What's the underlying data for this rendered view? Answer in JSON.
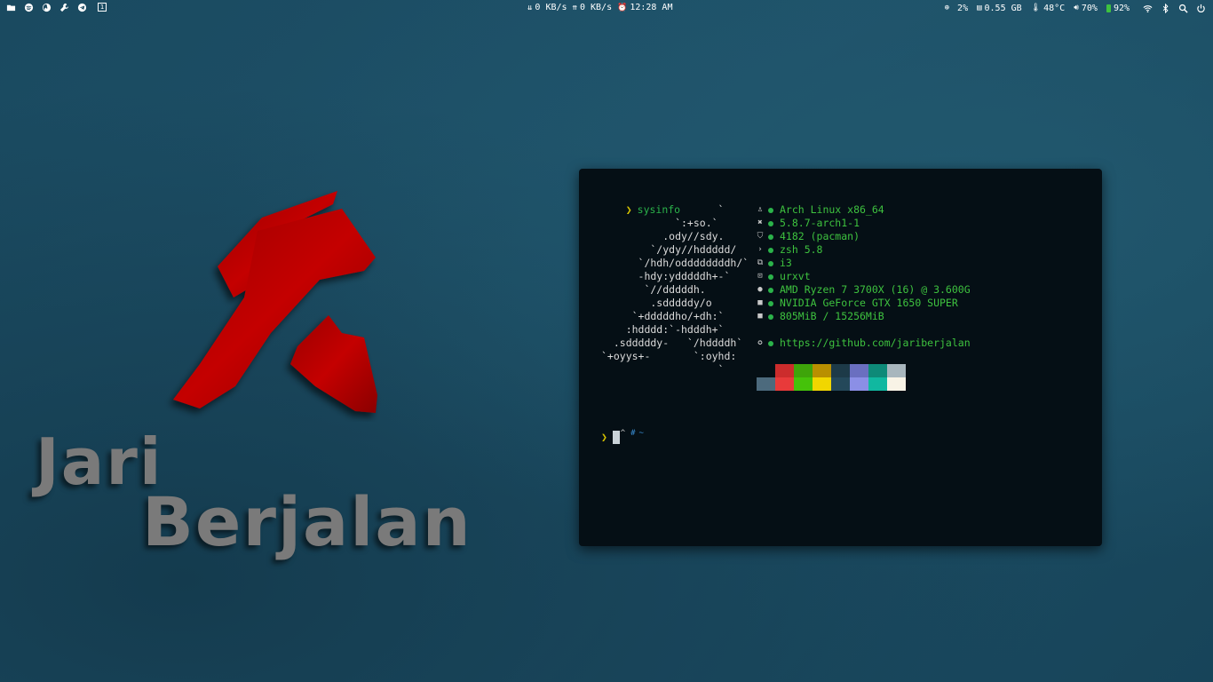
{
  "topbar": {
    "workspace": "1",
    "net_down": "0 KB/s",
    "net_up": "0 KB/s",
    "clock": "12:28 AM",
    "cpu": "2%",
    "memory": "0.55 GB",
    "temperature": "48°C",
    "volume": "70%",
    "battery": "92%",
    "left_icons": [
      "folder-icon",
      "spotify-icon",
      "firefox-icon",
      "settings-tool-icon",
      "telegram-icon"
    ],
    "right_icons": [
      "wifi-icon",
      "bluetooth-icon",
      "search-icon",
      "power-icon"
    ]
  },
  "wallpaper": {
    "line1": "Jari",
    "line2": "Berjalan",
    "logo_color": "#b30000"
  },
  "terminal": {
    "command": "sysinfo",
    "ascii_art": "                   `\n            `:+so.`\n          .ody//sdy.\n        `/ydy//hddddd/\n      `/hdh/oddddddddh/`\n      -hdy:ydddddh+-`\n       `//dddddh.\n        .sdddddy/o\n     `+dddddho/+dh:`\n    :hdddd:`-hdddh+`\n  .sdddddy-   `/hddddh`\n`+oyys+-       `:oyhd:\n                   `",
    "info": [
      {
        "icon": "arch-icon",
        "glyph": "♙",
        "text": "Arch Linux x86_64"
      },
      {
        "icon": "kernel-icon",
        "glyph": "✖",
        "text": "5.8.7-arch1-1"
      },
      {
        "icon": "package-icon",
        "glyph": "⛉",
        "text": "4182 (pacman)"
      },
      {
        "icon": "shell-icon",
        "glyph": "›",
        "text": "zsh 5.8"
      },
      {
        "icon": "wm-icon",
        "glyph": "⧉",
        "text": "i3"
      },
      {
        "icon": "terminal-icon",
        "glyph": "⊡",
        "text": "urxvt"
      },
      {
        "icon": "cpu-icon",
        "glyph": "●",
        "text": "AMD Ryzen 7 3700X (16) @ 3.600G"
      },
      {
        "icon": "gpu-icon",
        "glyph": "■",
        "text": "NVIDIA GeForce GTX 1650 SUPER"
      },
      {
        "icon": "memory-icon",
        "glyph": "■",
        "text": "805MiB / 15256MiB"
      },
      {
        "icon": "github-icon",
        "glyph": "✪",
        "text": "https://github.com/jariberjalan"
      }
    ],
    "palette_top": [
      "#050f15",
      "#cc2c2c",
      "#3ea40a",
      "#b98f00",
      "#1d3a48",
      "#6a6fc0",
      "#0e8a78",
      "#a8b6bd"
    ],
    "palette_bottom": [
      "#4c6a7d",
      "#e83a3a",
      "#45c20a",
      "#f1d600",
      "#24485a",
      "#8b8fe6",
      "#11b8a0",
      "#f8f3e6"
    ],
    "path_caret": "^",
    "path_hash": "#",
    "path_tilde": "~"
  }
}
